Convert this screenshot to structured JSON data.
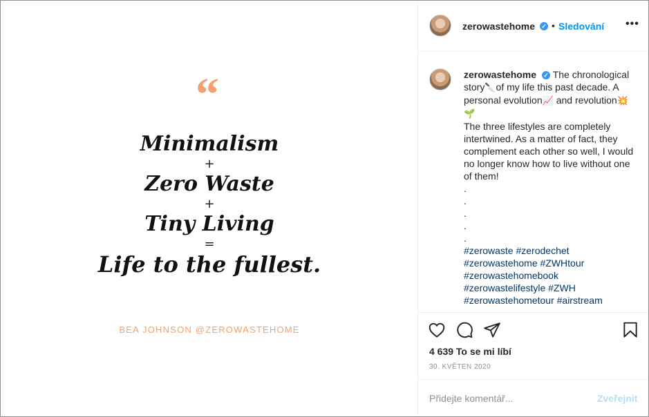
{
  "post": {
    "quote_mark": "“",
    "quote_lines": [
      "Minimalism",
      "+",
      "Zero Waste",
      "+",
      "Tiny Living",
      "=",
      "Life to the fullest."
    ],
    "author": "BEA JOHNSON @ZEROWASTEHOME"
  },
  "header": {
    "username": "zerowastehome",
    "verified_mark": "✓",
    "separator": "•",
    "follow_label": "Sledování",
    "more_label": "•••",
    "avatar_icon": "profile-avatar"
  },
  "caption": {
    "username": "zerowastehome",
    "intro": "The chronological story",
    "emoji_knife": "🔪",
    "text2": "of my life this past decade. A personal evolution",
    "emoji_chart": "📈",
    "text3": "and revolution",
    "emoji_boom": "💥",
    "emoji_seedling": "🌱",
    "body": "The three lifestyles are completely intertwined. As a matter of fact, they complement each other so well, I would no longer know how to live without one of them!",
    "dots": [
      ".",
      ".",
      ".",
      ".",
      "."
    ],
    "hashtags": [
      "#zerowaste #zerodechet",
      "#zerowastehome #ZWHtour",
      "#zerowastehomebook",
      "#zerowastelifestyle #ZWH",
      "#zerowastehometour #airstream"
    ]
  },
  "actions": {
    "like_icon": "heart-icon",
    "comment_icon": "comment-icon",
    "share_icon": "share-icon",
    "save_icon": "bookmark-icon",
    "likes_text": "4 639 To se mi líbí",
    "date": "30. KVĚTEN 2020"
  },
  "comment": {
    "placeholder": "Přidejte komentář...",
    "post_label": "Zveřejnit"
  },
  "colors": {
    "accent": "#0095f6",
    "quote_orange": "#f5a06a",
    "hashtag": "#00376b",
    "muted": "#8e8e8e"
  }
}
